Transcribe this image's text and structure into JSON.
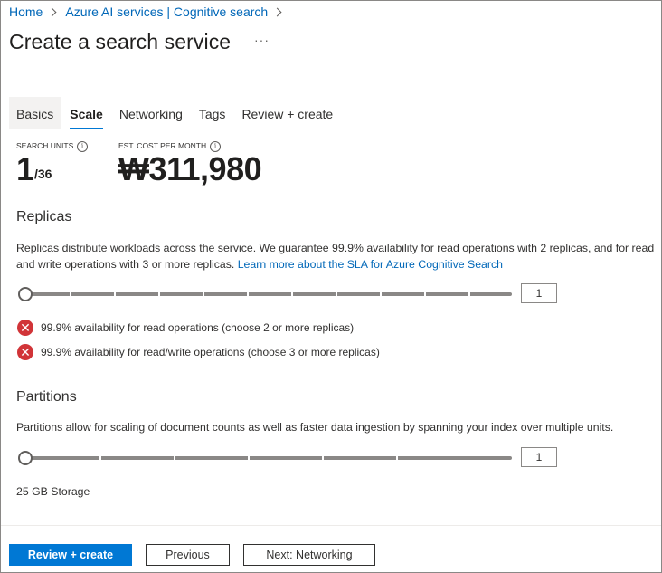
{
  "breadcrumb": [
    {
      "label": "Home"
    },
    {
      "label": "Azure AI services | Cognitive search"
    }
  ],
  "page": {
    "title": "Create a search service",
    "more_label": "···"
  },
  "tabs": [
    {
      "label": "Basics"
    },
    {
      "label": "Scale"
    },
    {
      "label": "Networking"
    },
    {
      "label": "Tags"
    },
    {
      "label": "Review + create"
    }
  ],
  "summary": {
    "units_label": "Search units",
    "units_value": "1",
    "units_max": "/36",
    "cost_label": "Est. cost per month",
    "cost_value": "₩311,980"
  },
  "replicas": {
    "title": "Replicas",
    "description": "Replicas distribute workloads across the service. We guarantee 99.9% availability for read operations with 2 replicas, and for read and write operations with 3 or more replicas.",
    "link_text": "Learn more about the SLA for Azure Cognitive Search",
    "value": "1",
    "slider_fraction": 0,
    "messages": [
      {
        "icon": "error-icon",
        "text": "99.9% availability for read operations (choose 2 or more replicas)"
      },
      {
        "icon": "error-icon",
        "text": "99.9% availability for read/write operations (choose 3 or more replicas)"
      }
    ]
  },
  "partitions": {
    "title": "Partitions",
    "description": "Partitions allow for scaling of document counts as well as faster data ingestion by spanning your index over multiple units.",
    "value": "1",
    "slider_fraction": 0,
    "storage_label": "25 GB Storage"
  },
  "footer": {
    "review_create": "Review + create",
    "previous": "Previous",
    "next": "Next: Networking"
  },
  "colors": {
    "accent": "#0078d4",
    "link": "#0067b8",
    "error": "#d13438"
  }
}
